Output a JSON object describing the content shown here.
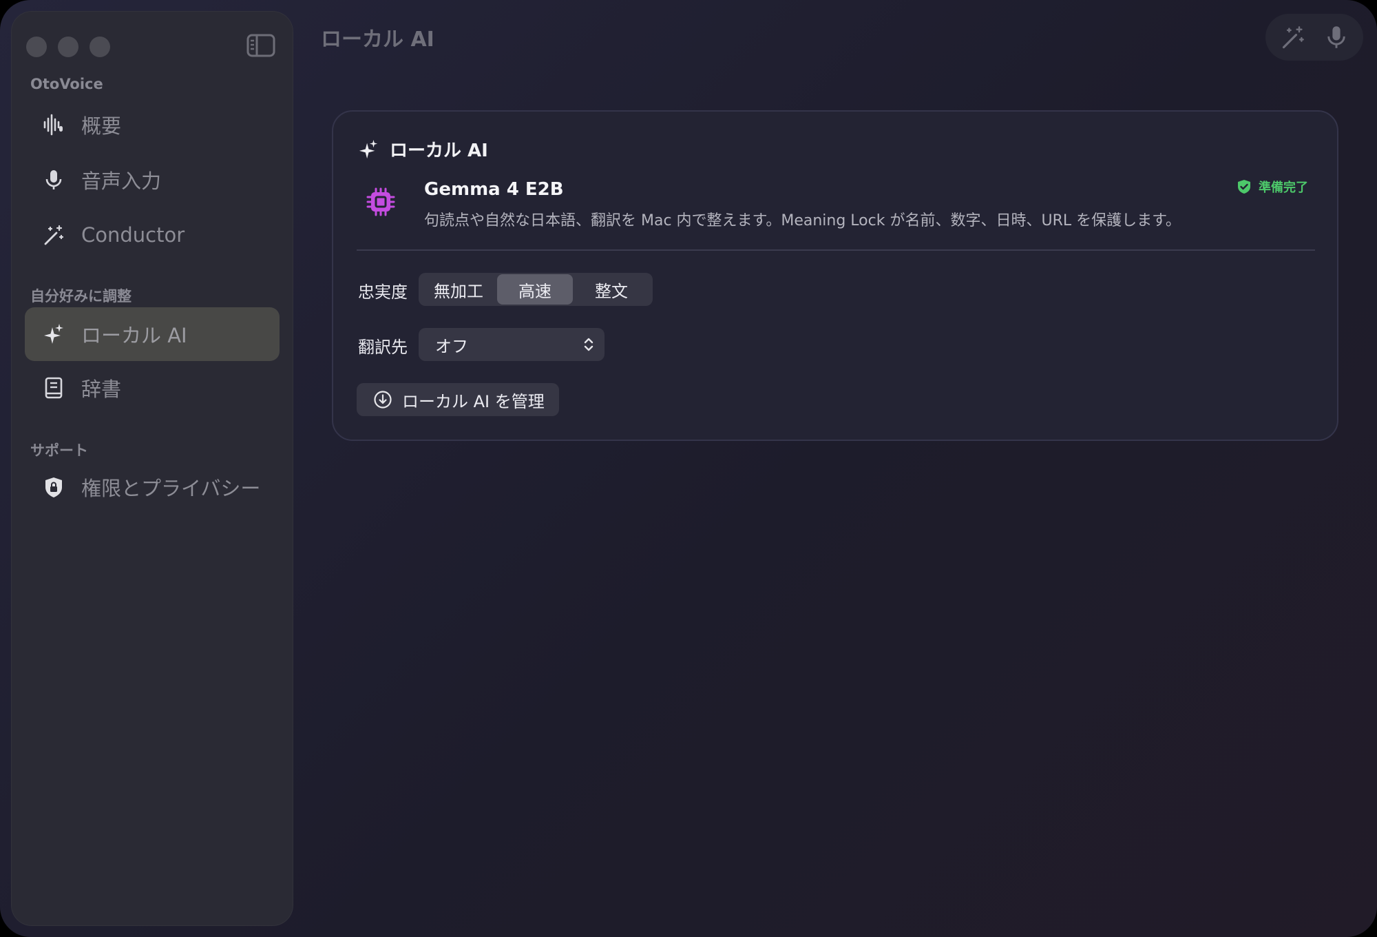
{
  "window": {
    "title": "ローカル AI"
  },
  "sidebar": {
    "sections": [
      {
        "label": "OtoVoice"
      },
      {
        "label": "自分好みに調整"
      },
      {
        "label": "サポート"
      }
    ],
    "items": [
      {
        "label": "概要",
        "icon": "waveform-icon"
      },
      {
        "label": "音声入力",
        "icon": "microphone-icon"
      },
      {
        "label": "Conductor",
        "icon": "magic-wand-icon"
      },
      {
        "label": "ローカル AI",
        "icon": "sparkles-icon",
        "active": true
      },
      {
        "label": "辞書",
        "icon": "book-icon"
      },
      {
        "label": "権限とプライバシー",
        "icon": "lock-shield-icon"
      }
    ]
  },
  "toolbar": {
    "actions": [
      "magic-wand-icon",
      "microphone-icon"
    ]
  },
  "card": {
    "title": "ローカル AI",
    "model": {
      "name": "Gemma 4 E2B",
      "description": "句読点や自然な日本語、翻訳を Mac 内で整えます。Meaning Lock が名前、数字、日時、URL を保護します。",
      "icon": "chip-icon"
    },
    "status": {
      "label": "準備完了",
      "color": "#4dc86a"
    },
    "fidelity": {
      "label": "忠実度",
      "options": [
        "無加工",
        "高速",
        "整文"
      ],
      "selected": "高速"
    },
    "translation": {
      "label": "翻訳先",
      "value": "オフ"
    },
    "manage_button": {
      "label": "ローカル AI を管理"
    }
  },
  "colors": {
    "accent_purple": "#c44ce0",
    "status_green": "#4dc86a"
  }
}
